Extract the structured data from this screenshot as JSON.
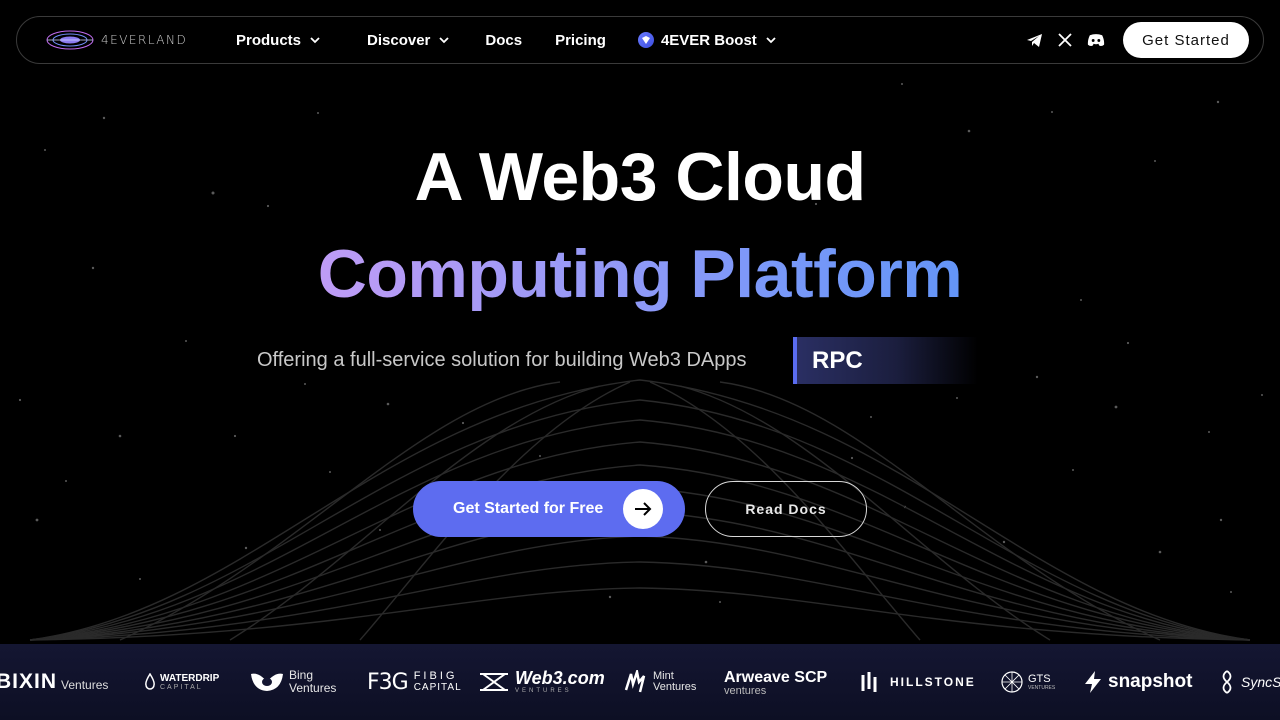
{
  "nav": {
    "logo_text": "4EVERLAND",
    "links": [
      {
        "label": "Products",
        "has_menu": true
      },
      {
        "label": "Discover",
        "has_menu": true
      },
      {
        "label": "Docs",
        "has_menu": false
      },
      {
        "label": "Pricing",
        "has_menu": false
      },
      {
        "label": "4EVER Boost",
        "has_menu": true
      }
    ],
    "socials": [
      "telegram-icon",
      "x-icon",
      "discord-icon"
    ],
    "cta_label": "Get Started"
  },
  "hero": {
    "title_line1": "A Web3 Cloud",
    "title_line2": "Computing Platform",
    "subtitle": "Offering a full-service solution for building Web3 DApps",
    "rotating_word": "RPC",
    "primary_cta": "Get Started for Free",
    "secondary_cta": "Read Docs"
  },
  "partners": [
    {
      "name": "BIXIN",
      "sub": "Ventures"
    },
    {
      "name": "WATERDRIP",
      "sub": "CAPITAL"
    },
    {
      "name": "Bing",
      "sub": "Ventures"
    },
    {
      "name": "FIBIG",
      "sub": "CAPITAL",
      "mark": "F3G"
    },
    {
      "name": "Web3.com",
      "sub": "VENTURES"
    },
    {
      "name": "Mint",
      "sub": "Ventures"
    },
    {
      "name": "Arweave SCP",
      "sub": "ventures"
    },
    {
      "name": "HILLSTONE"
    },
    {
      "name": "GTS",
      "sub": "VENTURES"
    },
    {
      "name": "snapshot"
    },
    {
      "name": "SyncSt"
    }
  ],
  "colors": {
    "accent": "#5d6cf0",
    "gradient_start": "#e9a2f5",
    "gradient_end": "#3f8ff5",
    "partner_bar": "#141632"
  }
}
